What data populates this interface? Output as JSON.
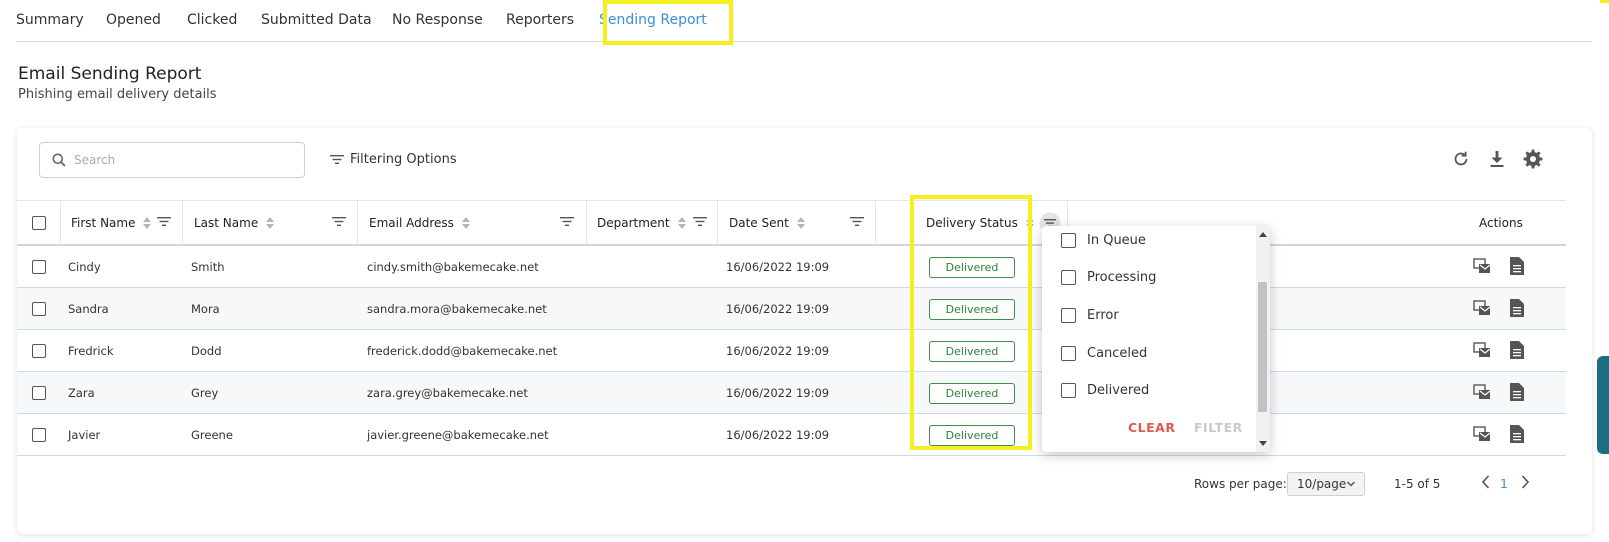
{
  "tabs": [
    {
      "label": "Summary",
      "active": false
    },
    {
      "label": "Opened",
      "active": false
    },
    {
      "label": "Clicked",
      "active": false
    },
    {
      "label": "Submitted Data",
      "active": false
    },
    {
      "label": "No Response",
      "active": false
    },
    {
      "label": "Reporters",
      "active": false
    },
    {
      "label": "Sending Report",
      "active": true
    }
  ],
  "header": {
    "title": "Email Sending Report",
    "subtitle": "Phishing email delivery details"
  },
  "toolbar": {
    "search_placeholder": "Search",
    "filter_options_label": "Filtering Options",
    "icons": [
      "refresh-icon",
      "download-icon",
      "gear-icon"
    ]
  },
  "table": {
    "columns": {
      "first_name": "First Name",
      "last_name": "Last Name",
      "email": "Email Address",
      "department": "Department",
      "date_sent": "Date Sent",
      "delivery_status": "Delivery Status",
      "actions": "Actions"
    },
    "rows": [
      {
        "first_name": "Cindy",
        "last_name": "Smith",
        "email": "cindy.smith@bakemecake.net",
        "department": "",
        "date_sent": "16/06/2022 19:09",
        "status": "Delivered"
      },
      {
        "first_name": "Sandra",
        "last_name": "Mora",
        "email": "sandra.mora@bakemecake.net",
        "department": "",
        "date_sent": "16/06/2022 19:09",
        "status": "Delivered"
      },
      {
        "first_name": "Fredrick",
        "last_name": "Dodd",
        "email": "frederick.dodd@bakemecake.net",
        "department": "",
        "date_sent": "16/06/2022 19:09",
        "status": "Delivered"
      },
      {
        "first_name": "Zara",
        "last_name": "Grey",
        "email": "zara.grey@bakemecake.net",
        "department": "",
        "date_sent": "16/06/2022 19:09",
        "status": "Delivered"
      },
      {
        "first_name": "Javier",
        "last_name": "Greene",
        "email": "javier.greene@bakemecake.net",
        "department": "",
        "date_sent": "16/06/2022 19:09",
        "status": "Delivered"
      }
    ]
  },
  "status_filter": {
    "options": [
      "In Queue",
      "Processing",
      "Error",
      "Canceled",
      "Delivered"
    ],
    "clear_label": "CLEAR",
    "filter_label": "FILTER"
  },
  "pagination": {
    "rows_per_page_label": "Rows per page:",
    "rows_per_page_value": "10/page",
    "range": "1-5 of 5",
    "current_page": "1"
  },
  "colors": {
    "accent": "#3b8fd6",
    "highlight": "#f5ef1f",
    "status_delivered": "#2f7f3a",
    "clear": "#e05a4f"
  }
}
